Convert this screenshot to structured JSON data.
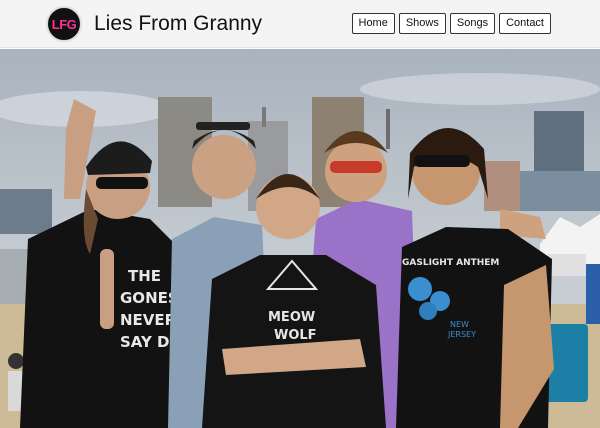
{
  "header": {
    "logo_text": "LFG",
    "site_title": "Lies From Granny",
    "nav": [
      {
        "label": "Home"
      },
      {
        "label": "Shows"
      },
      {
        "label": "Songs"
      },
      {
        "label": "Contact"
      }
    ]
  },
  "hero": {
    "shirt_text_left": [
      "THE",
      "GONES",
      "NEVER",
      "SAY DIE"
    ],
    "shirt_text_center": [
      "MEOW",
      "WOLF"
    ],
    "shirt_text_right": [
      "GASLIGHT ANTHEM",
      "NEW",
      "JERSEY"
    ]
  },
  "colors": {
    "logo_bg": "#111111",
    "logo_text": "#ff2f92",
    "header_bg": "#f4f4f4"
  }
}
